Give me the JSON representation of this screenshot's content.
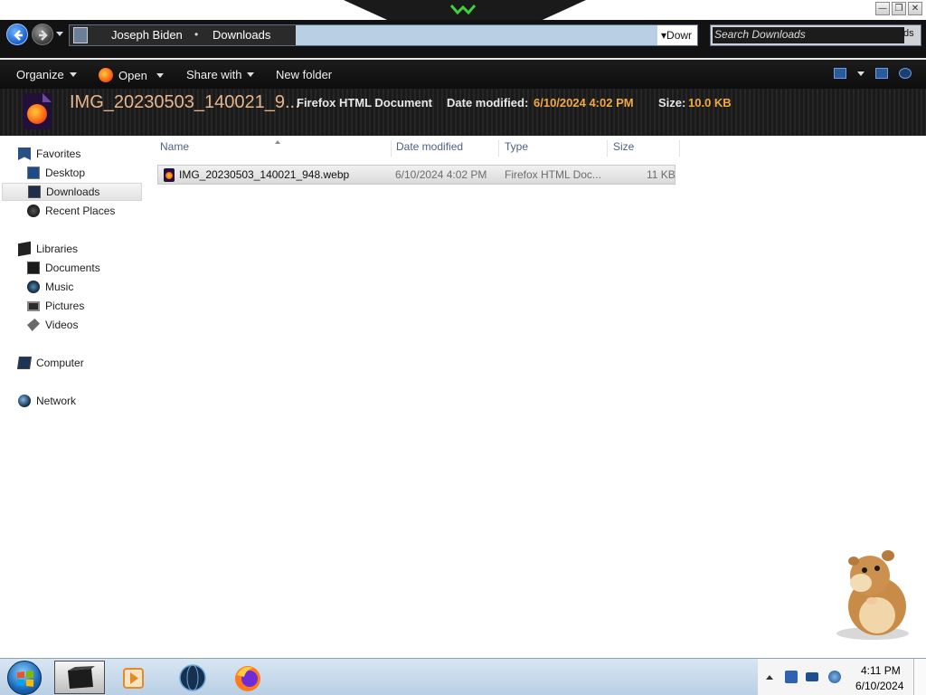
{
  "window": {
    "controls": [
      "—",
      "❐",
      "✕"
    ]
  },
  "address_bar": {
    "breadcrumbs": [
      "Joseph Biden",
      "Downloads"
    ],
    "separator": "•",
    "overflow_text": "Dowr",
    "search_placeholder": "Search Downloads",
    "search_tail": "ds"
  },
  "toolbar": {
    "organize": "Organize",
    "open": "Open",
    "share_with": "Share with",
    "new_folder": "New folder"
  },
  "details_pane": {
    "file_name": "IMG_20230503_140021_9...",
    "file_type": "Firefox HTML Document",
    "date_modified_label": "Date modified:",
    "date_modified_value": "6/10/2024 4:02 PM",
    "size_label": "Size:",
    "size_value": "10.0 KB"
  },
  "navigation": {
    "favorites": "Favorites",
    "desktop": "Desktop",
    "downloads": "Downloads",
    "recent_places": "Recent Places",
    "libraries": "Libraries",
    "documents": "Documents",
    "music": "Music",
    "pictures": "Pictures",
    "videos": "Videos",
    "computer": "Computer",
    "network": "Network"
  },
  "file_list": {
    "columns": {
      "name": "Name",
      "date_modified": "Date modified",
      "type": "Type",
      "size": "Size"
    },
    "rows": [
      {
        "name": "IMG_20230503_140021_948.webp",
        "date_modified": "6/10/2024 4:02 PM",
        "type": "Firefox HTML Doc...",
        "size": "11 KB"
      }
    ]
  },
  "taskbar": {
    "clock_time": "4:11 PM",
    "clock_date": "6/10/2024"
  },
  "colors": {
    "details_name": "#e8b58a",
    "details_value": "#f2a844",
    "column_header": "#4d6185",
    "taskbar": "#c8dbec"
  }
}
